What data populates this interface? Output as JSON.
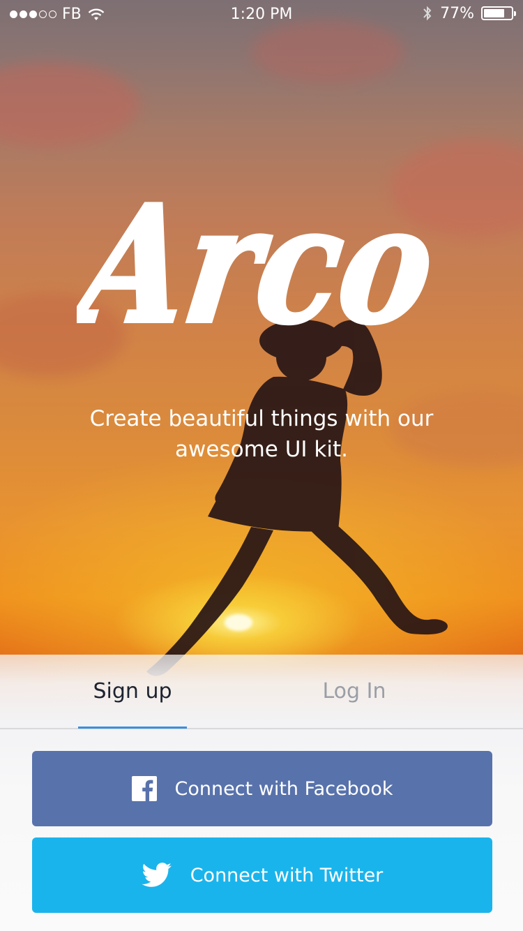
{
  "status_bar": {
    "carrier": "FB",
    "time": "1:20 PM",
    "battery_percent_text": "77%",
    "battery_level": 0.77,
    "signal_bars": 3,
    "signal_total": 5
  },
  "hero": {
    "logo_text": "Arco",
    "tagline_line1": "Create beautiful things with our",
    "tagline_line2": "awesome UI kit."
  },
  "tabs": [
    {
      "label": "Sign up",
      "active": true
    },
    {
      "label": "Log In",
      "active": false
    }
  ],
  "buttons": {
    "facebook": {
      "label": "Connect with Facebook",
      "color": "#5872ab",
      "icon": "facebook-icon"
    },
    "twitter": {
      "label": "Connect with Twitter",
      "color": "#1ab4ec",
      "icon": "twitter-icon"
    }
  },
  "colors": {
    "tab_indicator": "#3a8fe0",
    "active_tab_text": "#1c2330",
    "inactive_tab_text": "#9a9ea6"
  }
}
